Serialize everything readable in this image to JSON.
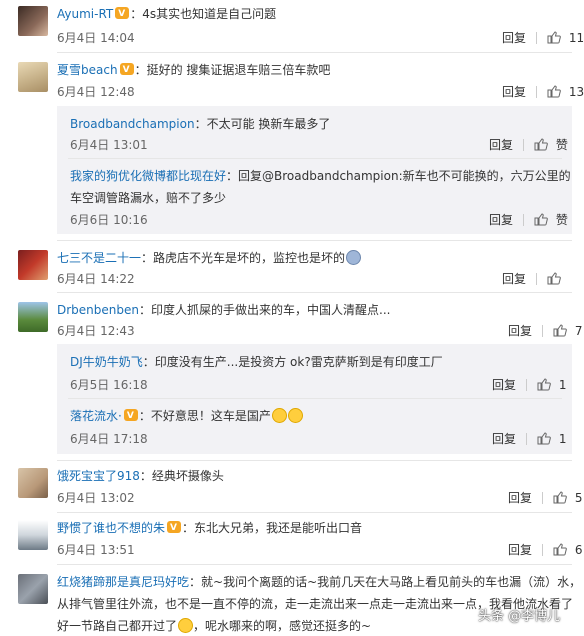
{
  "actions": {
    "reply": "回复",
    "like": "赞"
  },
  "watermark": "头条 @李博儿",
  "comments": [
    {
      "user": "Ayumi-RT",
      "text": "4s其实也知道是自己问题",
      "time": "6月4日 14:04",
      "likes": "11"
    },
    {
      "user": "夏雪beach",
      "text": "挺好的 搜集证据退车赔三倍车款吧",
      "time": "6月4日 12:48",
      "likes": "13",
      "replies": [
        {
          "user": "Broadbandchampion",
          "text": "不太可能 换新车最多了",
          "time": "6月4日 13:01",
          "like_label": "赞"
        },
        {
          "user": "我家的狗优化微博都比现在好",
          "text_line1": "回复@Broadbandchampion:新车也不可能换的，六万公里的",
          "text_line2": "车空调管路漏水，赔不了多少",
          "time": "6月6日 10:16",
          "like_label": "赞"
        }
      ]
    },
    {
      "user": "七三不是二十一",
      "text": "路虎店不光车是坏的，监控也是坏的",
      "time": "6月4日 14:22",
      "likes": ""
    },
    {
      "user": "Drbenbenben",
      "text": "印度人抓屎的手做出来的车，中国人清醒点...",
      "time": "6月4日 12:43",
      "likes": "7",
      "replies": [
        {
          "user": "DJ牛奶牛奶飞",
          "text": "印度没有生产...是投资方 ok?雷克萨斯到是有印度工厂",
          "time": "6月5日 16:18",
          "likes": "1"
        },
        {
          "user": "落花流水·",
          "text": "不好意思！这车是国产",
          "time": "6月4日 17:18",
          "likes": "1"
        }
      ]
    },
    {
      "user": "饿死宝宝了918",
      "text": "经典坏摄像头",
      "time": "6月4日 13:02",
      "likes": "5"
    },
    {
      "user": "野惯了谁也不想的朱",
      "text": "东北大兄弟，我还是能听出口音",
      "time": "6月4日 13:51",
      "likes": "6"
    },
    {
      "user": "红烧猪蹄那是真尼玛好吃",
      "text_line1": "就~我问个离题的话~我前几天在大马路上看见前头的车也漏（流）水，",
      "text_line2": "从排气管里往外流，也不是一直不停的流，走一走流出来一点走一走流出来一点，我看他流水看了",
      "text_line3": "好一节路自己都开过了",
      "text_line3b": "，呢水哪来的啊，感觉还挺多的~"
    }
  ]
}
